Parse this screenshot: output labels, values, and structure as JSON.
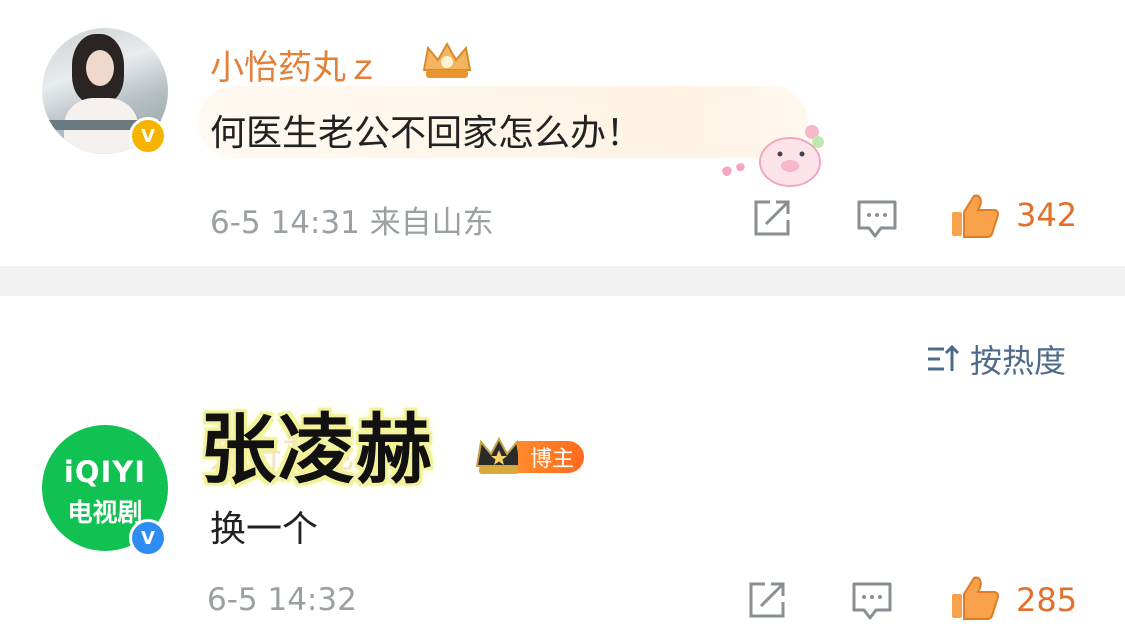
{
  "comments": [
    {
      "username": "小怡药丸ｚ",
      "text": "何医生老公不回家怎么办！",
      "date": "6-5 14:31",
      "location": "来自山东",
      "likes": "342",
      "avatar_badge": "V",
      "icons": {
        "share": "share-icon",
        "reply": "comment-icon",
        "like": "thumbs-up-icon"
      }
    },
    {
      "username_overlay": "张凌赫",
      "username_obscured": "爱奇艺电视剧",
      "badge": "博主",
      "text": "换一个",
      "date": "6-5 14:32",
      "likes": "285",
      "avatar_logo": "iQIYI",
      "avatar_sub": "电视剧",
      "avatar_badge": "V"
    }
  ],
  "sort": {
    "label": "按热度"
  },
  "colors": {
    "username": "#e37f36",
    "like": "#e26f2a",
    "meta": "#9aa0a6",
    "sort": "#4e6b8c",
    "divider": "#f1f1f2"
  }
}
